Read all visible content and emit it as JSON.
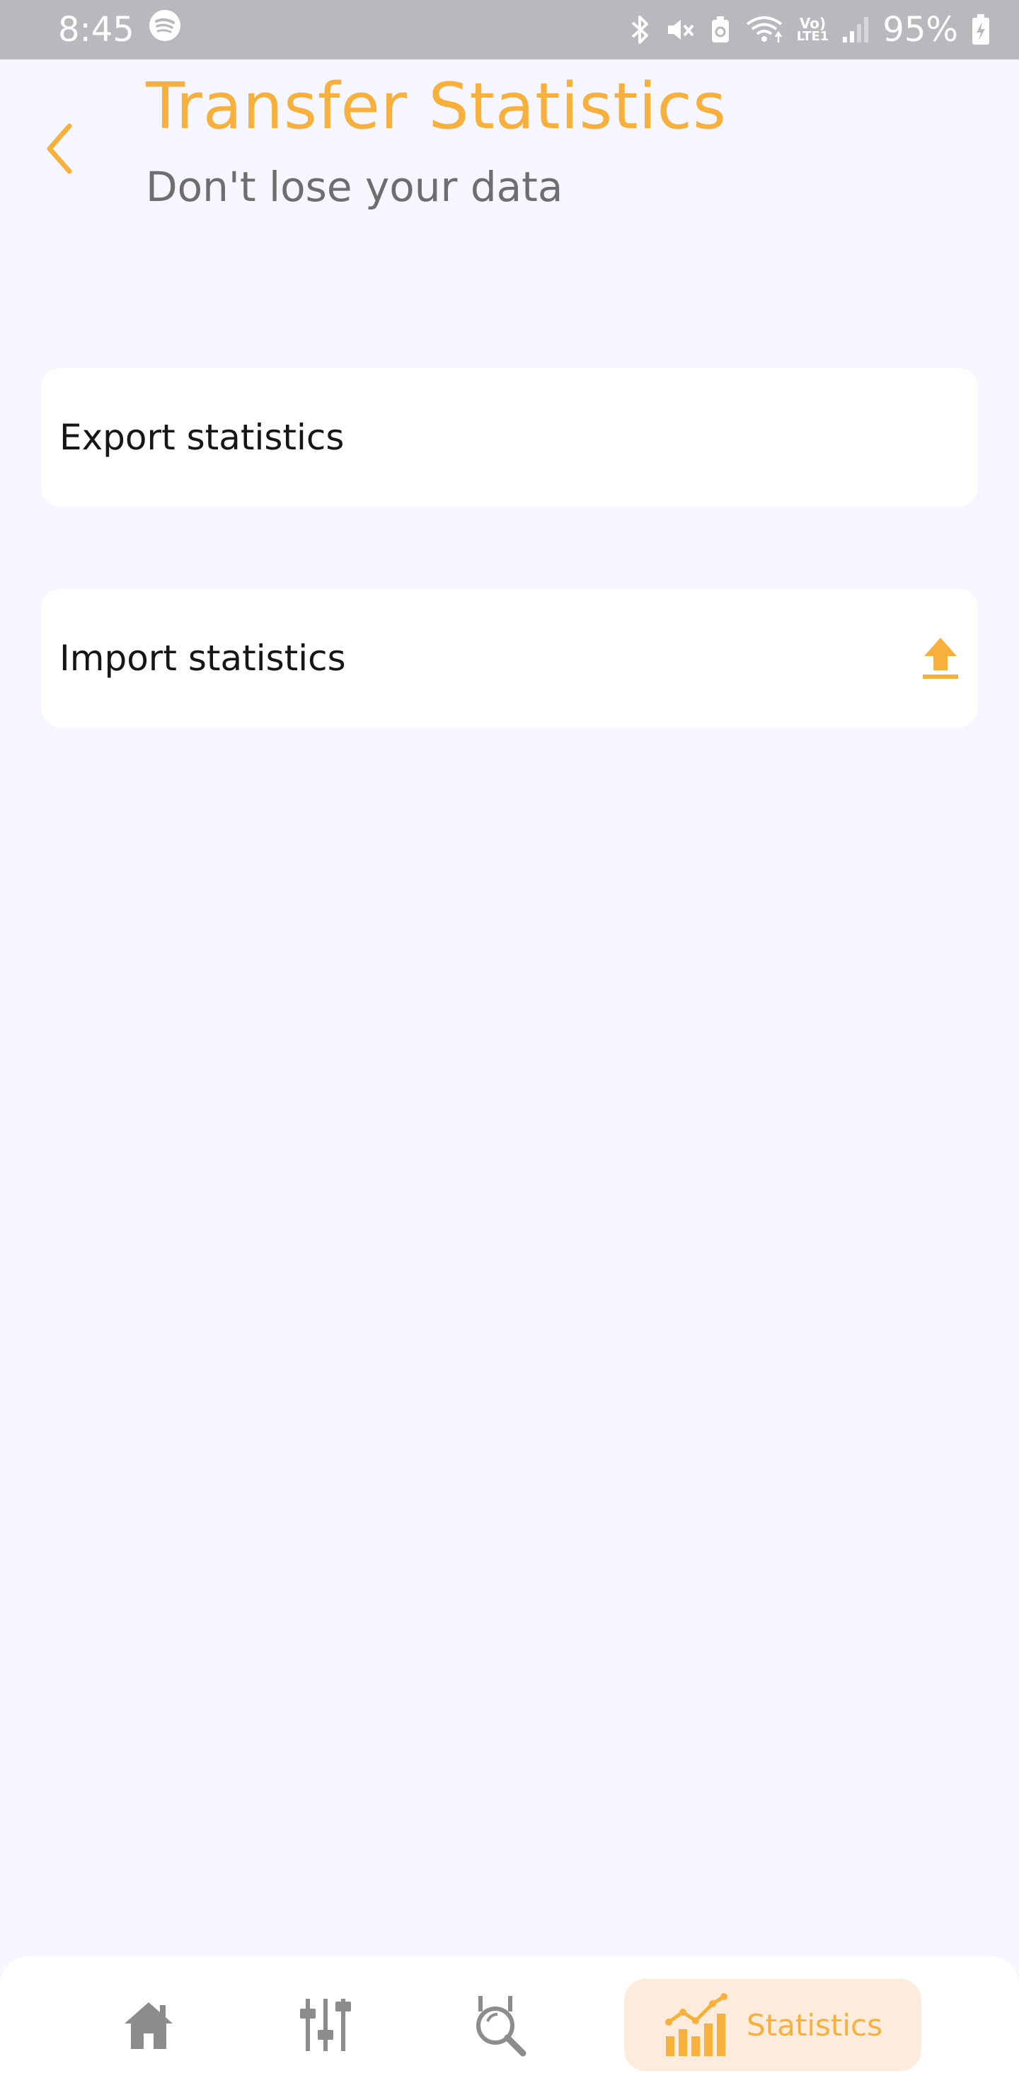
{
  "status_bar": {
    "time": "8:45",
    "battery": "95%",
    "icons": [
      "spotify-icon",
      "bluetooth-icon",
      "mute-icon",
      "battery-saver-icon",
      "wifi-icon",
      "volte-icon",
      "signal-icon",
      "battery-icon"
    ],
    "volte_label_top": "Vo)",
    "volte_label_bottom": "LTE1"
  },
  "header": {
    "title": "Transfer Statistics",
    "subtitle": "Don't lose your data",
    "back_icon": "chevron-left-icon"
  },
  "options": [
    {
      "label": "Export statistics",
      "icon": ""
    },
    {
      "label": "Import statistics",
      "icon": "upload-icon"
    }
  ],
  "bottom_nav": {
    "items": [
      {
        "icon": "home-icon",
        "label": "",
        "active": false
      },
      {
        "icon": "equalizer-icon",
        "label": "",
        "active": false
      },
      {
        "icon": "search-icon",
        "label": "",
        "active": false
      },
      {
        "icon": "statistics-chart-icon",
        "label": "Statistics",
        "active": true
      }
    ]
  },
  "colors": {
    "accent": "#F7B03C",
    "background": "#F5F6FE",
    "active_pill": "#FDEBDB",
    "inactive_icon": "#8C8C8C",
    "status_bar": "#B9B8BD"
  }
}
